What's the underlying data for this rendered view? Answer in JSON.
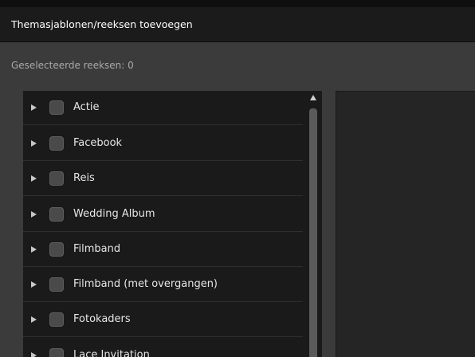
{
  "dialog": {
    "title": "Themasjablonen/reeksen toevoegen",
    "selected_count": "Geselecteerde reeksen: 0"
  },
  "series_list": {
    "items": [
      {
        "label": "Actie",
        "checked": false
      },
      {
        "label": "Facebook",
        "checked": false
      },
      {
        "label": "Reis",
        "checked": false
      },
      {
        "label": "Wedding Album",
        "checked": false
      },
      {
        "label": "Filmband",
        "checked": false
      },
      {
        "label": "Filmband (met overgangen)",
        "checked": false
      },
      {
        "label": "Fotokaders",
        "checked": false
      },
      {
        "label": "Lace Invitation",
        "checked": false
      }
    ]
  },
  "colors": {
    "title_bar": "#1b1b1b",
    "panel_background": "#1a1a1a",
    "dialog_background": "#3b3b3b"
  }
}
